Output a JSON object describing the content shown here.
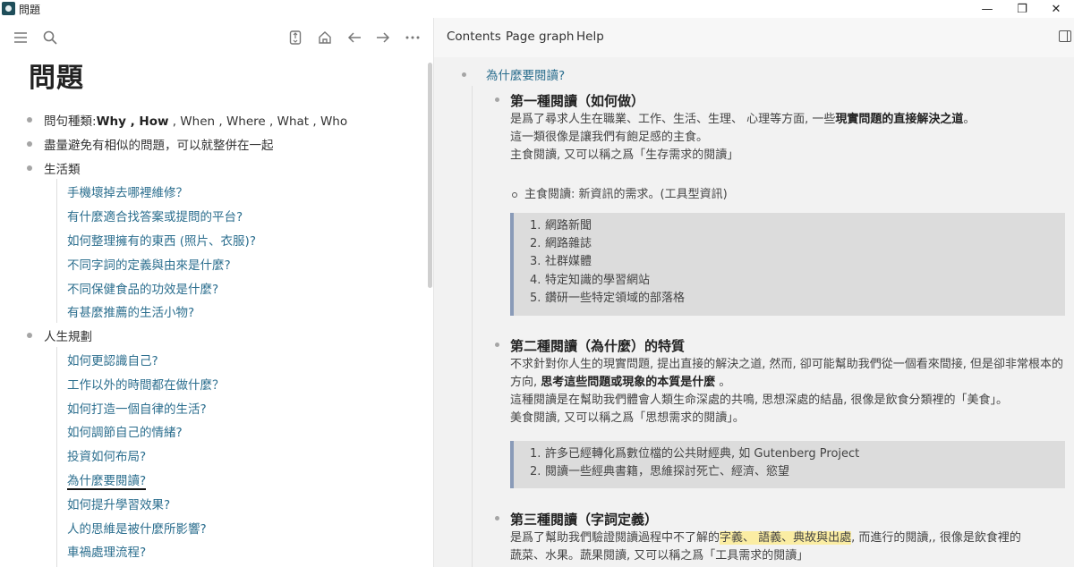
{
  "window": {
    "title": "問題",
    "min_glyph": "—",
    "max_glyph": "❐",
    "close_glyph": "✕"
  },
  "left": {
    "page_title": "問題",
    "items": [
      {
        "prefix": "問句種類:",
        "bold": "Why , How",
        "rest": " , When , Where , What , Who"
      },
      {
        "text": "盡量避免有相似的問題，可以就整併在一起"
      },
      {
        "text": "生活類"
      },
      {
        "text": "人生規劃"
      }
    ],
    "group_life": [
      "手機壞掉去哪裡維修？",
      "有什麼適合找答案或提問的平台?",
      "如何整理擁有的東西 (照片、衣服)?",
      "不同字詞的定義與由來是什麼?",
      "不同保健食品的功效是什麼?",
      "有甚麼推薦的生活小物?"
    ],
    "group_plan": [
      "如何更認識自己?",
      "工作以外的時間都在做什麼？",
      "如何打造一個自律的生活?",
      "如何調節自己的情緒?",
      "投資如何布局?",
      "為什麼要閱讀?",
      "如何提升學習效果?",
      "人的思維是被什麼所影響?",
      "車禍處理流程?"
    ]
  },
  "right": {
    "tabs": [
      "Contents",
      "Page graph",
      "Help"
    ],
    "root": "為什麼要閱讀?",
    "s1": {
      "title": "第一種閱讀（如何做）",
      "p1a": "是爲了尋求人生在職業、工作、生活、生理、 心理等方面, 一些",
      "p1b": "現實問題的直接解決之道",
      "p1c": "。",
      "p2": "這一類很像是讓我們有飽足感的主食。",
      "p3": "主食閱讀, 又可以稱之爲「生存需求的閱讀」",
      "sub": "主食閱讀: 新資訊的需求。(工具型資訊)",
      "list": [
        "網路新聞",
        "網路雜誌",
        "社群媒體",
        "特定知識的學習網站",
        "鑽研一些特定領域的部落格"
      ]
    },
    "s2": {
      "title": "第二種閱讀（為什麼）的特質",
      "p1a": "不求針對你人生的現實問題, 提出直接的解決之道, 然而, 卻可能幫助我們從一個看來間接, 但是卻非常根本的方向, ",
      "p1b": "思考這些問題或現象的本質是什麼",
      "p1c": " 。",
      "p2": "這種閱讀是在幫助我們體會人類生命深處的共鳴, 思想深處的結晶, 很像是飲食分類裡的「美食」。",
      "p3": "美食閱讀, 又可以稱之爲「思想需求的閱讀」。",
      "list": [
        "許多已經轉化爲數位檔的公共財經典, 如 Gutenberg Project",
        "閱讀一些經典書籍，思維探討死亡、經濟、慾望"
      ]
    },
    "s3": {
      "title": "第三種閱讀（字詞定義）",
      "p1a": "是爲了幫助我們驗證閱讀過程中不了解的",
      "p1b": "字義、 語義、典故與出處",
      "p1c": ", 而進行的閱讀,, 很像是飲食裡的",
      "p2": "蔬菜、水果。蔬果閱讀, 又可以稱之爲「工具需求的閱讀」"
    }
  }
}
